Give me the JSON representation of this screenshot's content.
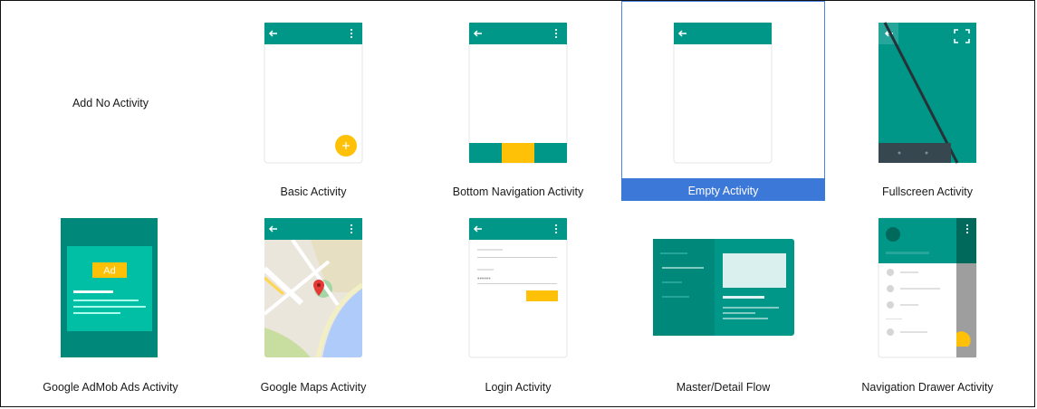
{
  "templates": [
    {
      "key": "no_activity",
      "label": "Add No Activity"
    },
    {
      "key": "basic",
      "label": "Basic Activity"
    },
    {
      "key": "bottom_nav",
      "label": "Bottom Navigation Activity"
    },
    {
      "key": "empty",
      "label": "Empty Activity"
    },
    {
      "key": "fullscreen",
      "label": "Fullscreen Activity"
    },
    {
      "key": "admob",
      "label": "Google AdMob Ads Activity"
    },
    {
      "key": "maps",
      "label": "Google Maps Activity"
    },
    {
      "key": "login",
      "label": "Login Activity"
    },
    {
      "key": "master_detail",
      "label": "Master/Detail Flow"
    },
    {
      "key": "nav_drawer",
      "label": "Navigation Drawer Activity"
    }
  ],
  "selected_template": "Empty Activity",
  "admob_badge": "Ad",
  "login_password_mask": "••••••",
  "icons": {
    "back": "arrow-left-icon",
    "overflow": "more-vert-icon",
    "fab": "plus-icon",
    "fullscreen": "fullscreen-icon",
    "map_pin": "map-marker-icon"
  },
  "colors": {
    "teal": "#009688",
    "dark_teal": "#00796b",
    "amber": "#ffc107",
    "selection": "#3c78d8"
  }
}
